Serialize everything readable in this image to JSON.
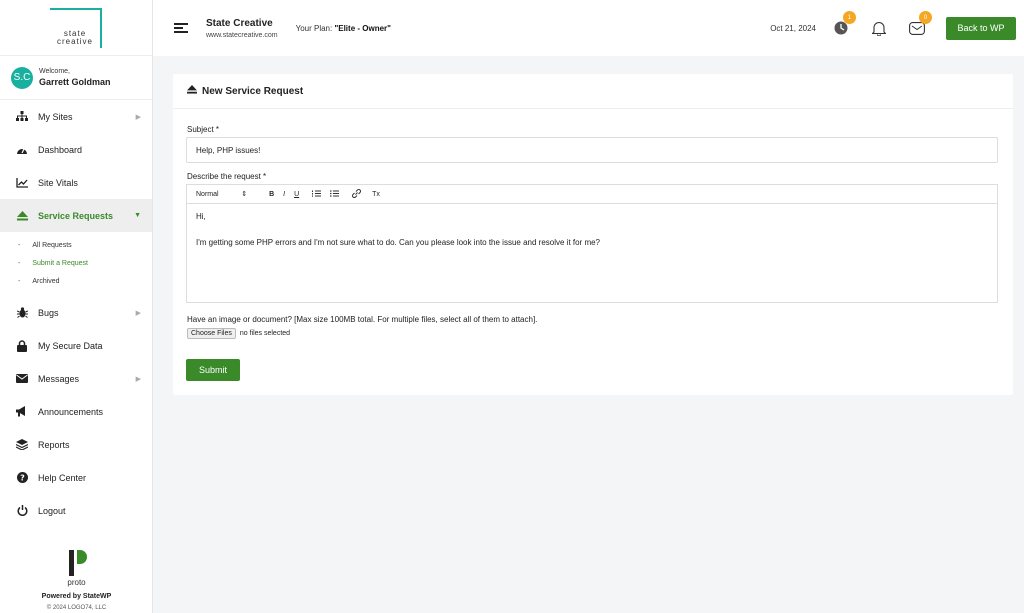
{
  "sidebar": {
    "logo": {
      "line1": "state",
      "line2": "creative"
    },
    "welcome": {
      "avatar": "S.C",
      "greeting": "Welcome,",
      "name": "Garrett Goldman"
    },
    "items": [
      {
        "label": "My Sites",
        "icon": "sitemap-icon"
      },
      {
        "label": "Dashboard",
        "icon": "gauge-icon"
      },
      {
        "label": "Site Vitals",
        "icon": "chart-line-icon"
      },
      {
        "label": "Service Requests",
        "icon": "eject-icon"
      },
      {
        "label": "Bugs",
        "icon": "bug-icon"
      },
      {
        "label": "My Secure Data",
        "icon": "lock-icon"
      },
      {
        "label": "Messages",
        "icon": "envelope-icon"
      },
      {
        "label": "Announcements",
        "icon": "megaphone-icon"
      },
      {
        "label": "Reports",
        "icon": "layers-icon"
      },
      {
        "label": "Help Center",
        "icon": "question-circle-icon"
      },
      {
        "label": "Logout",
        "icon": "power-icon"
      }
    ],
    "sub_items": [
      {
        "label": "All Requests"
      },
      {
        "label": "Submit a Request"
      },
      {
        "label": "Archived"
      }
    ],
    "footer": {
      "proto": "proto",
      "powered": "Powered by StateWP",
      "copyright": "© 2024 LOGO74, LLC"
    }
  },
  "header": {
    "site_name": "State Creative",
    "site_url": "www.statecreative.com",
    "plan_label": "Your Plan:",
    "plan_value": "\"Elite - Owner\"",
    "date": "Oct 21, 2024",
    "clock_badge": "1",
    "mail_badge": "0",
    "back_button": "Back to WP"
  },
  "form": {
    "title": "New Service Request",
    "subject_label": "Subject *",
    "subject_value": "Help, PHP issues!",
    "describe_label": "Describe the request *",
    "toolbar": {
      "format": "Normal",
      "bold": "B",
      "italic": "I",
      "underline": "U",
      "clear": "Tx"
    },
    "editor_line1": "Hi,",
    "editor_line2": "I'm getting some PHP errors and I'm not sure what to do. Can you please look into the issue and resolve it for me?",
    "attach_label": "Have an image or document? [Max size 100MB total. For multiple files, select all of them to attach].",
    "choose_files": "Choose Files",
    "no_files": "no files selected",
    "submit": "Submit"
  },
  "colors": {
    "accent": "#3a8a2a",
    "teal": "#1ab0a0",
    "badge": "#f5a623"
  }
}
